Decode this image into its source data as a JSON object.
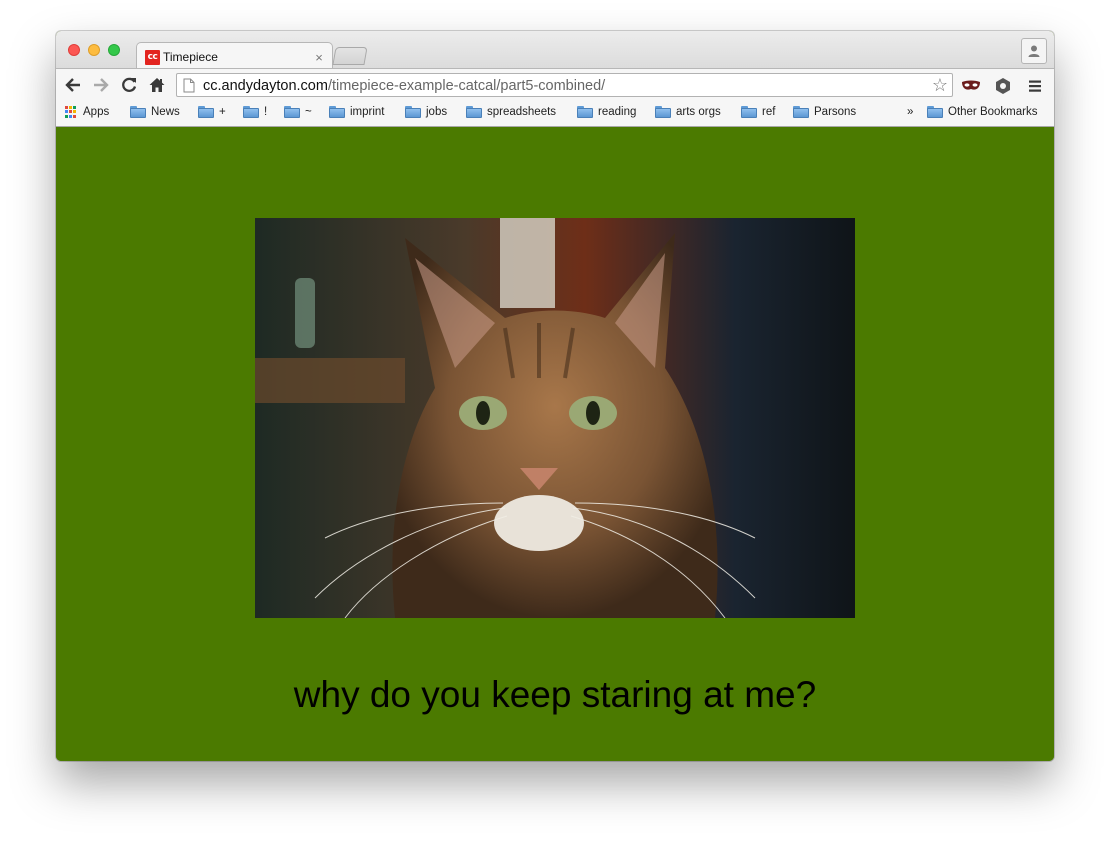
{
  "window": {
    "tab": {
      "favicon_text": "cc",
      "title": "Timepiece",
      "close_glyph": "×"
    }
  },
  "toolbar": {
    "url_host": "cc.andydayton.com",
    "url_path": "/timepiece-example-catcal/part5-combined/"
  },
  "bookmarks": {
    "apps_label": "Apps",
    "items": [
      "News",
      "+",
      "!",
      "~",
      "imprint",
      "jobs",
      "spreadsheets",
      "reading",
      "arts orgs",
      "ref",
      "Parsons"
    ],
    "overflow_glyph": "»",
    "other_label": "Other Bookmarks"
  },
  "page": {
    "background_color": "#4b7a00",
    "image_subject": "cat-portrait",
    "caption": "why do you keep staring at me?"
  }
}
